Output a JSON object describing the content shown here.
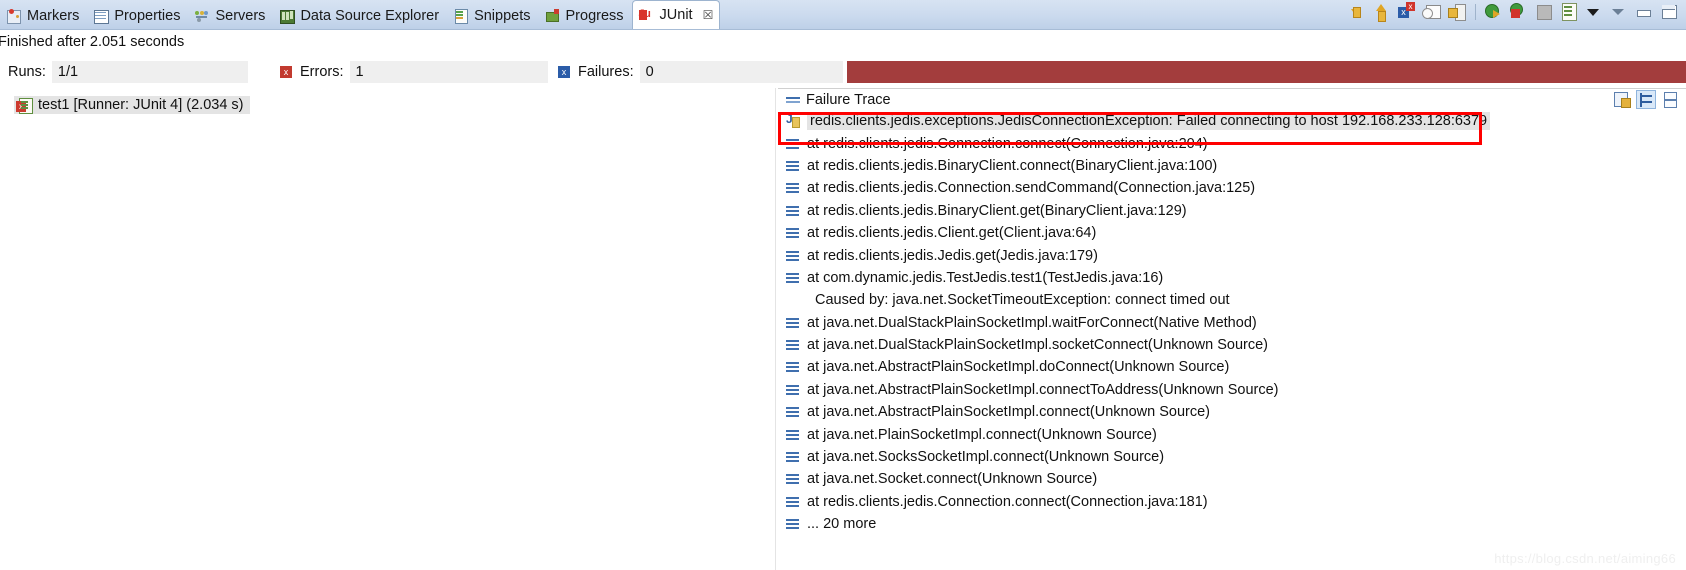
{
  "tabs": [
    {
      "label": "Markers",
      "icon": "markers-icon",
      "icon_class": "ic-markers",
      "active": false
    },
    {
      "label": "Properties",
      "icon": "properties-icon",
      "icon_class": "ic-props",
      "active": false
    },
    {
      "label": "Servers",
      "icon": "servers-icon",
      "icon_class": "ic-servers",
      "active": false
    },
    {
      "label": "Data Source Explorer",
      "icon": "data-source-explorer-icon",
      "icon_class": "ic-ds",
      "active": false
    },
    {
      "label": "Snippets",
      "icon": "snippets-icon",
      "icon_class": "ic-snip",
      "active": false
    },
    {
      "label": "Progress",
      "icon": "progress-icon",
      "icon_class": "ic-prog",
      "active": false
    },
    {
      "label": "JUnit",
      "icon": "junit-icon",
      "icon_class": "ic-junit",
      "active": true,
      "close_glyph": "☒"
    }
  ],
  "toolbar": {
    "buttons": [
      {
        "name": "next-failure-button",
        "icon": "arrow-down-icon",
        "cls": "arw-wrap down"
      },
      {
        "name": "previous-failure-button",
        "icon": "arrow-up-icon",
        "cls": "arw-wrap up"
      },
      {
        "name": "show-failures-only-button",
        "icon": "failures-only-icon",
        "cls": "ic-failnav"
      },
      {
        "name": "filter-stack-trace-button",
        "icon": "filter-icon",
        "cls": "ic-filter"
      },
      {
        "name": "lock-view-button",
        "icon": "lock-icon",
        "cls": "ic-lock"
      },
      {
        "name": "separator",
        "icon": "separator",
        "cls": "sep"
      },
      {
        "name": "rerun-test-button",
        "icon": "rerun-icon",
        "cls": "ic-rerun"
      },
      {
        "name": "rerun-failed-tests-button",
        "icon": "rerun-failed-icon",
        "cls": "ic-rerunfail"
      },
      {
        "name": "stop-button",
        "icon": "stop-icon",
        "cls": "ic-stop"
      },
      {
        "name": "test-run-history-button",
        "icon": "history-icon",
        "cls": "ic-hist"
      },
      {
        "name": "view-menu-button",
        "icon": "chevron-down-icon",
        "cls": "ic-caret"
      },
      {
        "name": "minimize-view-button",
        "icon": "minimize-icon",
        "cls": "ic-min"
      },
      {
        "name": "restore-view-button",
        "icon": "restore-icon",
        "cls": "ic-minbar"
      },
      {
        "name": "maximize-view-button",
        "icon": "maximize-icon",
        "cls": "ic-max"
      }
    ]
  },
  "status": {
    "finished_text": "Finished after 2.051 seconds"
  },
  "counters": {
    "runs_label": "Runs:",
    "runs_value": "1/1",
    "errors_label": "Errors:",
    "errors_value": "1",
    "failures_label": "Failures:",
    "failures_value": "0",
    "progress_color": "#a33d3d",
    "progress_percent": 100
  },
  "test_tree": {
    "items": [
      {
        "label": "test1 [Runner: JUnit 4] (2.034 s)",
        "icon": "test-error-icon",
        "selected": true
      }
    ]
  },
  "failure_trace": {
    "title": "Failure Trace",
    "actions": [
      {
        "name": "copy-trace-button",
        "icon": "copy-icon",
        "cls": "ic-copytrace",
        "active": false
      },
      {
        "name": "compare-result-button",
        "icon": "compare-icon",
        "cls": "ic-compare",
        "active": true
      },
      {
        "name": "toggle-view-button",
        "icon": "toggle-view-icon",
        "cls": "ic-toggleview",
        "active": false
      }
    ],
    "lines": [
      {
        "text": "redis.clients.jedis.exceptions.JedisConnectionException: Failed connecting to host 192.168.233.128:6379",
        "icon": "exception-icon",
        "kind": "exception",
        "selected": true
      },
      {
        "text": "at redis.clients.jedis.Connection.connect(Connection.java:204)",
        "icon": "stack-frame-icon",
        "kind": "frame"
      },
      {
        "text": "at redis.clients.jedis.BinaryClient.connect(BinaryClient.java:100)",
        "icon": "stack-frame-icon",
        "kind": "frame"
      },
      {
        "text": "at redis.clients.jedis.Connection.sendCommand(Connection.java:125)",
        "icon": "stack-frame-icon",
        "kind": "frame"
      },
      {
        "text": "at redis.clients.jedis.BinaryClient.get(BinaryClient.java:129)",
        "icon": "stack-frame-icon",
        "kind": "frame"
      },
      {
        "text": "at redis.clients.jedis.Client.get(Client.java:64)",
        "icon": "stack-frame-icon",
        "kind": "frame"
      },
      {
        "text": "at redis.clients.jedis.Jedis.get(Jedis.java:179)",
        "icon": "stack-frame-icon",
        "kind": "frame"
      },
      {
        "text": "at com.dynamic.jedis.TestJedis.test1(TestJedis.java:16)",
        "icon": "stack-frame-icon",
        "kind": "frame"
      },
      {
        "text": "Caused by: java.net.SocketTimeoutException: connect timed out",
        "icon": "none",
        "kind": "caused-by"
      },
      {
        "text": "at java.net.DualStackPlainSocketImpl.waitForConnect(Native Method)",
        "icon": "stack-frame-icon",
        "kind": "frame"
      },
      {
        "text": "at java.net.DualStackPlainSocketImpl.socketConnect(Unknown Source)",
        "icon": "stack-frame-icon",
        "kind": "frame"
      },
      {
        "text": "at java.net.AbstractPlainSocketImpl.doConnect(Unknown Source)",
        "icon": "stack-frame-icon",
        "kind": "frame"
      },
      {
        "text": "at java.net.AbstractPlainSocketImpl.connectToAddress(Unknown Source)",
        "icon": "stack-frame-icon",
        "kind": "frame"
      },
      {
        "text": "at java.net.AbstractPlainSocketImpl.connect(Unknown Source)",
        "icon": "stack-frame-icon",
        "kind": "frame"
      },
      {
        "text": "at java.net.PlainSocketImpl.connect(Unknown Source)",
        "icon": "stack-frame-icon",
        "kind": "frame"
      },
      {
        "text": "at java.net.SocksSocketImpl.connect(Unknown Source)",
        "icon": "stack-frame-icon",
        "kind": "frame"
      },
      {
        "text": "at java.net.Socket.connect(Unknown Source)",
        "icon": "stack-frame-icon",
        "kind": "frame"
      },
      {
        "text": "at redis.clients.jedis.Connection.connect(Connection.java:181)",
        "icon": "stack-frame-icon",
        "kind": "frame"
      },
      {
        "text": "... 20 more",
        "icon": "stack-frame-icon",
        "kind": "frame"
      }
    ]
  },
  "watermark": {
    "text": "https://blog.csdn.net/aiming66"
  }
}
